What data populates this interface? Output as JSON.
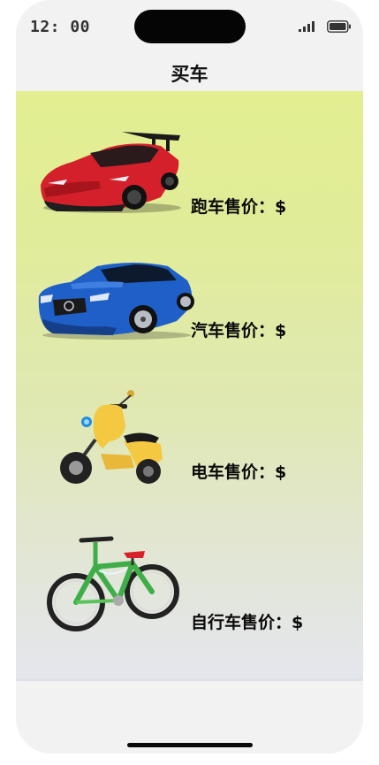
{
  "status_bar": {
    "time": "12: 00"
  },
  "nav": {
    "title": "买车"
  },
  "vehicles": [
    {
      "label": "跑车售价：$",
      "icon": "sports-car-image"
    },
    {
      "label": "汽车售价：$",
      "icon": "car-image"
    },
    {
      "label": "电车售价：$",
      "icon": "electric-scooter-image"
    },
    {
      "label": "自行车售价：$",
      "icon": "bicycle-image"
    }
  ],
  "colors": {
    "gradient_top": "#e2ee90",
    "gradient_bottom": "#e4e6ee",
    "chrome": "#f2f2f2"
  }
}
